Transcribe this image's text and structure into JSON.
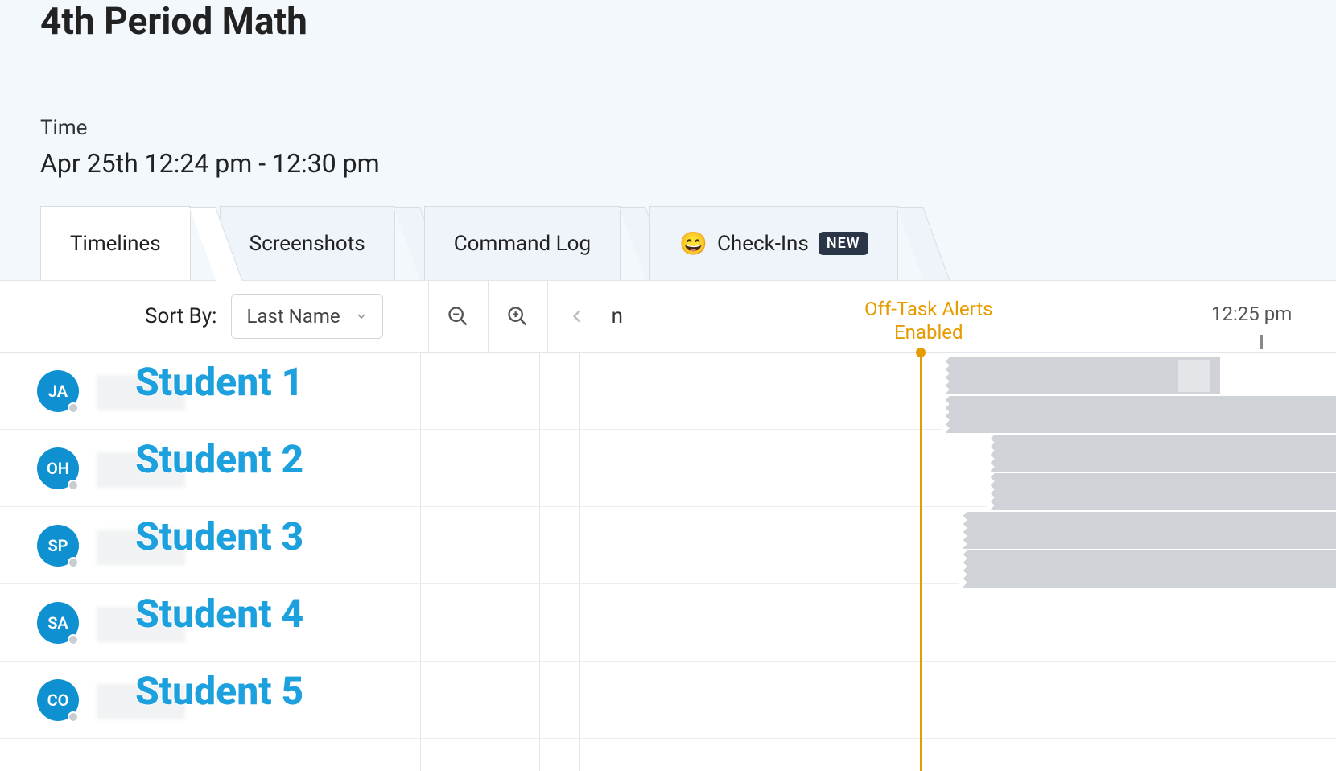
{
  "header": {
    "title": "4th Period Math",
    "time_label": "Time",
    "time_range": "Apr 25th 12:24 pm - 12:30 pm"
  },
  "tabs": [
    {
      "label": "Timelines",
      "active": true
    },
    {
      "label": "Screenshots",
      "active": false
    },
    {
      "label": "Command Log",
      "active": false
    },
    {
      "label": "Check-Ins",
      "active": false,
      "emoji": "😄",
      "badge": "NEW"
    }
  ],
  "toolbar": {
    "sort_label": "Sort By:",
    "sort_value": "Last Name",
    "trailing_text": "n"
  },
  "timeline": {
    "offtask_label_line1": "Off-Task Alerts",
    "offtask_label_line2": "Enabled",
    "axis_time_label": "12:25 pm"
  },
  "students": [
    {
      "initials": "JA",
      "display": "Student 1"
    },
    {
      "initials": "OH",
      "display": "Student 2"
    },
    {
      "initials": "SP",
      "display": "Student 3"
    },
    {
      "initials": "SA",
      "display": "Student 4"
    },
    {
      "initials": "CO",
      "display": "Student 5"
    }
  ]
}
